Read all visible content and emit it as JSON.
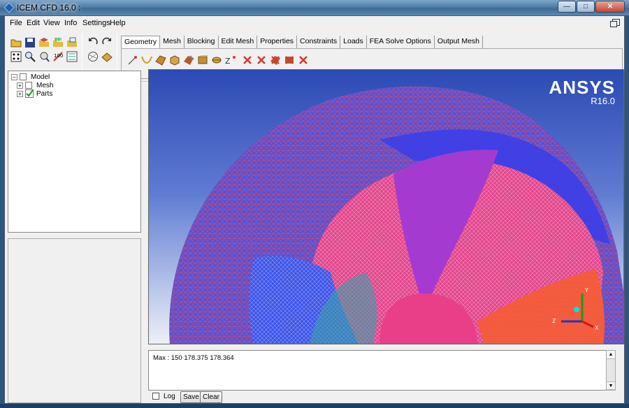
{
  "window": {
    "title": "ICEM CFD 16.0 :"
  },
  "menu": [
    "File",
    "Edit",
    "View",
    "Info",
    "Settings",
    "Help"
  ],
  "tabs": [
    "Geometry",
    "Mesh",
    "Blocking",
    "Edit Mesh",
    "Properties",
    "Constraints",
    "Loads",
    "FEA Solve Options",
    "Output Mesh"
  ],
  "active_tab": "Geometry",
  "tree": {
    "root": "Model",
    "children": [
      "Mesh",
      "Parts"
    ]
  },
  "viewport": {
    "brand": "ANSYS",
    "version": "R16.0"
  },
  "console": {
    "text": "Max : 150 178.375 178.364"
  },
  "bottom": {
    "log_label": "Log",
    "save": "Save",
    "clear": "Clear"
  },
  "colors": {
    "mesh_blue": "#3a4ff0",
    "mesh_pink": "#e0407a",
    "mesh_red": "#ff5030",
    "viewport_top": "#2c4ab4"
  },
  "toolbar_icons": [
    "open-icon",
    "save-icon",
    "geometry-open-icon",
    "mesh-open-icon",
    "blocking-icon",
    "undo-icon",
    "redo-icon",
    "fit-icon",
    "zoom-icon",
    "measure-icon",
    "display-icon",
    "shade-icon",
    "wire-icon",
    "points-icon",
    "curves-icon",
    "surfaces-icon",
    "bodies-icon",
    "delete-icon"
  ]
}
